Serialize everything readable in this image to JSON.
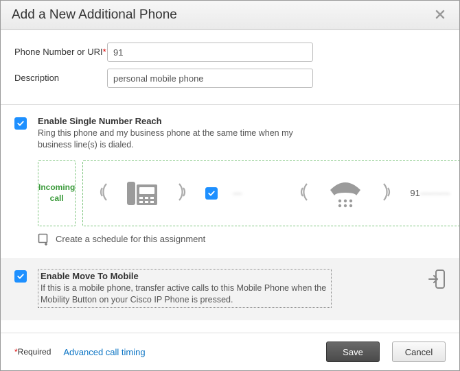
{
  "dialog": {
    "title": "Add a New Additional Phone"
  },
  "form": {
    "phone_label": "Phone Number or URI",
    "phone_value": "91",
    "desc_label": "Description",
    "desc_value": "personal mobile phone"
  },
  "snr": {
    "title": "Enable Single Number Reach",
    "desc": "Ring this phone and my business phone at the same time when my business line(s) is dialed.",
    "incoming_label": "Incoming call",
    "desk_number": "—",
    "mobile_number": "91",
    "schedule_label": "Create a schedule for this assignment"
  },
  "move": {
    "title": "Enable Move To Mobile",
    "desc": "If this is a mobile phone, transfer active calls to this Mobile Phone when the Mobility Button on your Cisco IP Phone is pressed."
  },
  "footer": {
    "required_marker": "*",
    "required_text": "Required",
    "advanced_link": "Advanced call timing",
    "save": "Save",
    "cancel": "Cancel"
  }
}
